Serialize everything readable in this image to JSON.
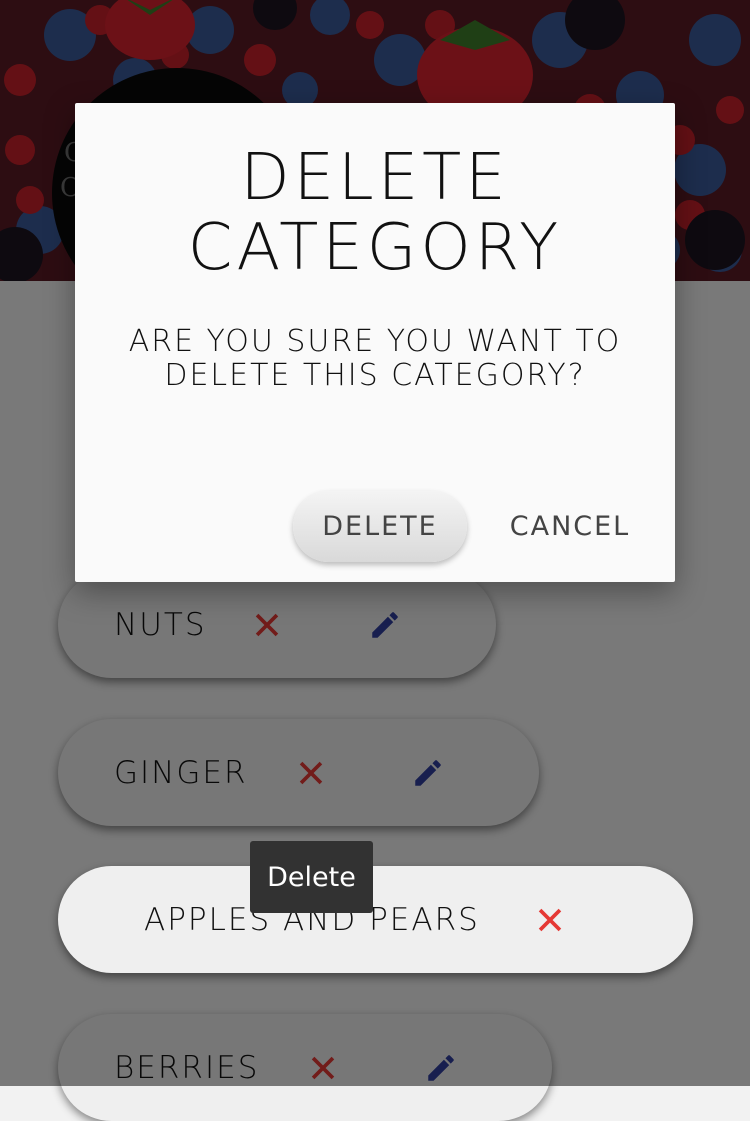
{
  "categories": [
    {
      "label": "NUTS",
      "delete_icon": "close-icon",
      "edit_icon": "pencil-icon"
    },
    {
      "label": "GINGER",
      "delete_icon": "close-icon",
      "edit_icon": "pencil-icon"
    },
    {
      "label": "APPLES AND PEARS",
      "delete_icon": "close-icon"
    },
    {
      "label": "BERRIES",
      "delete_icon": "close-icon",
      "edit_icon": "pencil-icon"
    }
  ],
  "tooltip": {
    "text": "Delete"
  },
  "dialog": {
    "title": "DELETE CATEGORY",
    "message": "ARE YOU SURE YOU WANT TO DELETE THIS CATEGORY?",
    "delete_label": "DELETE",
    "cancel_label": "CANCEL"
  },
  "colors": {
    "delete_icon": "#e53935",
    "edit_icon": "#303f9f",
    "scrim": "rgba(0,0,0,0.5)",
    "dialog_bg": "#fafafa",
    "tooltip_bg": "#323232"
  }
}
